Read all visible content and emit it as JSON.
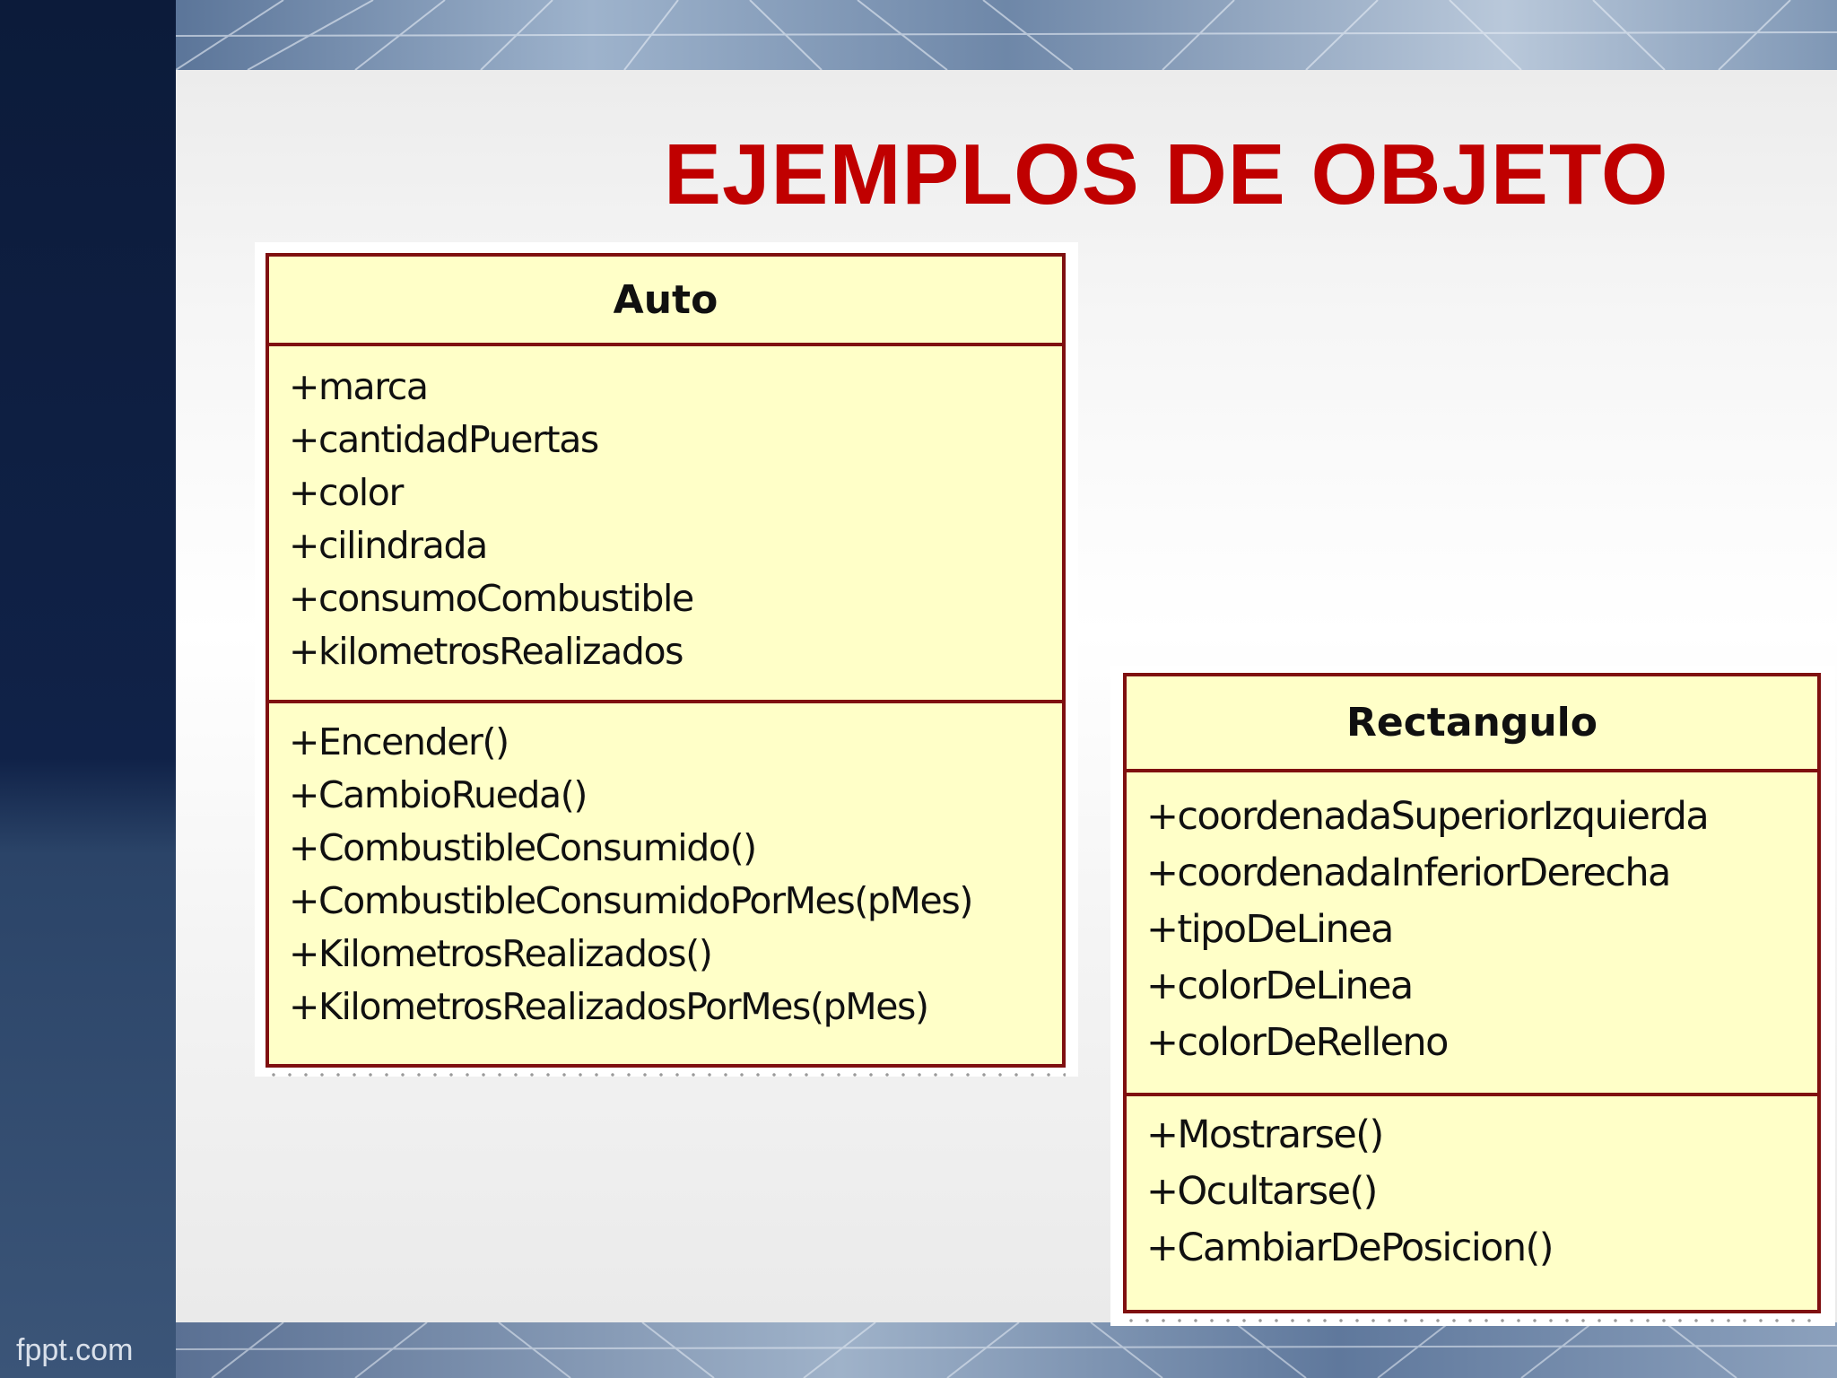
{
  "title": "EJEMPLOS DE OBJETO",
  "footer": "fppt.com",
  "classes": [
    {
      "name": "Auto",
      "attributes": [
        "+marca",
        "+cantidadPuertas",
        "+color",
        "+cilindrada",
        "+consumoCombustible",
        "+kilometrosRealizados"
      ],
      "operations": [
        "+Encender()",
        "+CambioRueda()",
        "+CombustibleConsumido()",
        "+CombustibleConsumidoPorMes(pMes)",
        "+KilometrosRealizados()",
        "+KilometrosRealizadosPorMes(pMes)"
      ]
    },
    {
      "name": "Rectangulo",
      "attributes": [
        "+coordenadaSuperiorIzquierda",
        "+coordenadaInferiorDerecha",
        "+tipoDeLinea",
        "+colorDeLinea",
        "+colorDeRelleno"
      ],
      "operations": [
        "+Mostrarse()",
        "+Ocultarse()",
        "+CambiarDePosicion()"
      ]
    }
  ],
  "colors": {
    "title": "#c00000",
    "uml_fill": "#ffffc8",
    "uml_border": "#7f1010"
  }
}
